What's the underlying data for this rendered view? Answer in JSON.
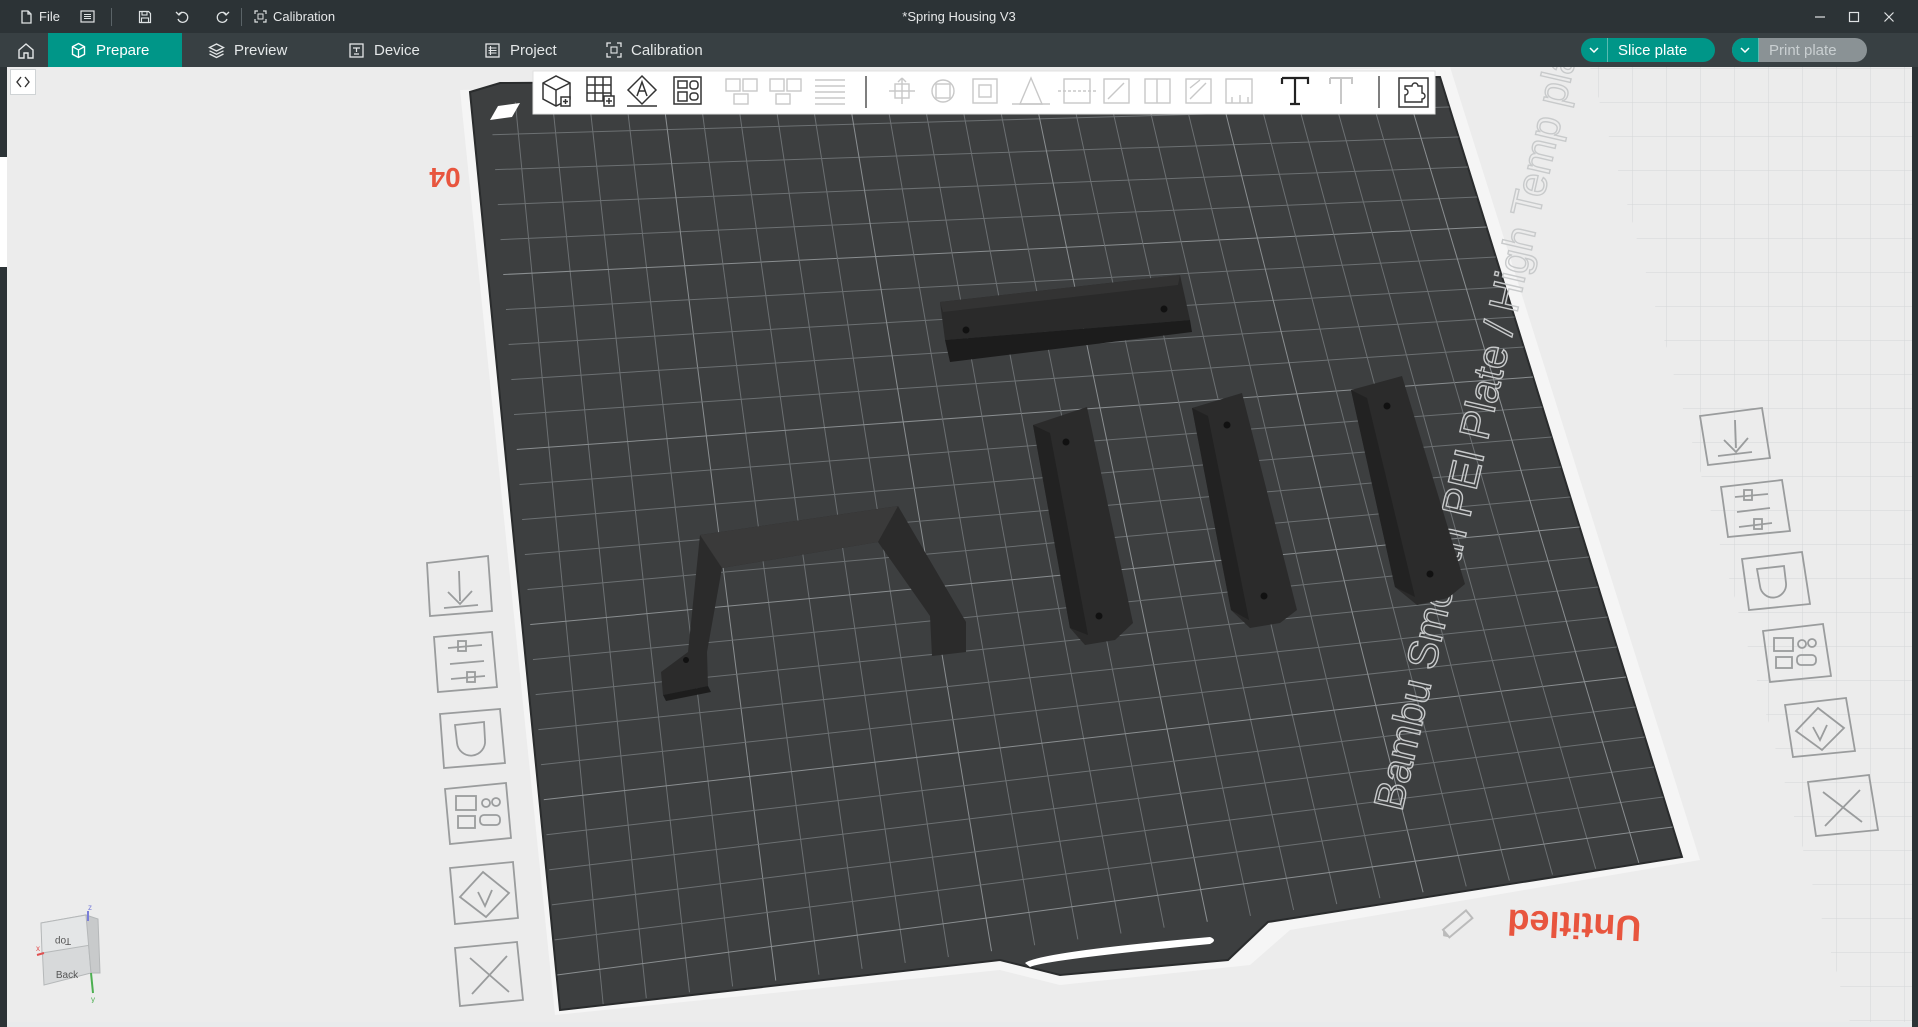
{
  "titlebar": {
    "file_label": "File",
    "calibration_label": "Calibration",
    "document_title": "*Spring Housing V3"
  },
  "tabs": [
    {
      "label": "Prepare",
      "icon": "cube-icon",
      "active": true
    },
    {
      "label": "Preview",
      "icon": "layers-icon",
      "active": false
    },
    {
      "label": "Device",
      "icon": "device-icon",
      "active": false
    },
    {
      "label": "Project",
      "icon": "project-icon",
      "active": false
    },
    {
      "label": "Calibration",
      "icon": "calibration-icon",
      "active": false
    }
  ],
  "actions": {
    "slice_label": "Slice plate",
    "print_label": "Print plate"
  },
  "plate": {
    "plate_type_text": "Bambu Smooth PEI Plate / High Temp plate",
    "plate_number": "04",
    "plate_name": "Untitled"
  },
  "view_cube": {
    "top_label": "Top",
    "back_label": "Back",
    "axis_x": "x",
    "axis_y": "y",
    "axis_z": "z"
  },
  "colors": {
    "accent": "#009688",
    "plate_surface": "#3d3f40",
    "grid_line": "#6c7072",
    "model": "#2a2a2a",
    "plate_label": "#e8553e",
    "titlebar_bg": "#2c3336",
    "toolbar_bg": "#384043"
  }
}
